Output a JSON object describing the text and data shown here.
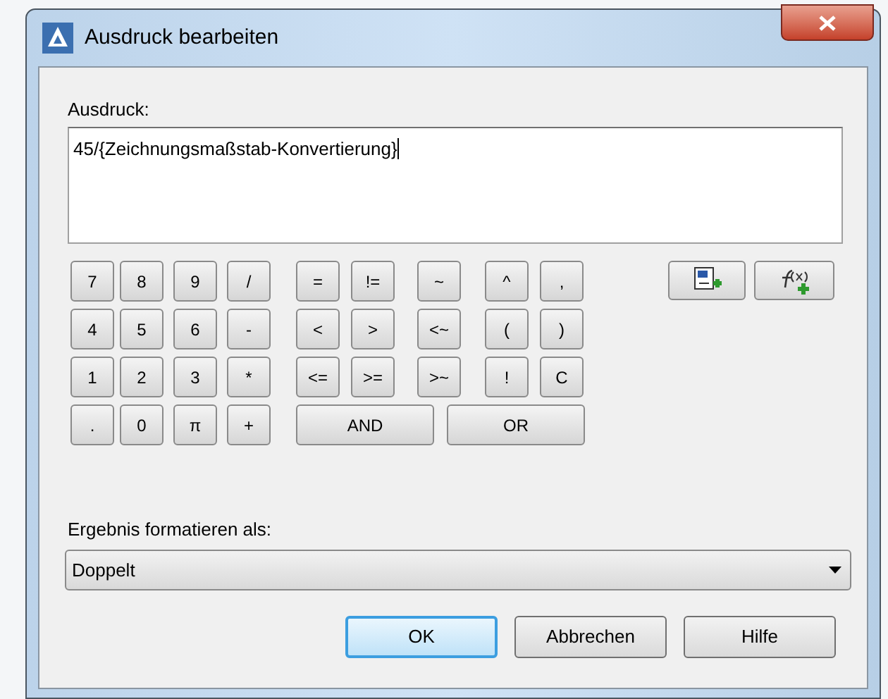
{
  "window": {
    "title": "Ausdruck bearbeiten"
  },
  "expression": {
    "label": "Ausdruck:",
    "value": "45/{Zeichnungsmaßstab-Konvertierung}"
  },
  "keypad": [
    [
      {
        "label": "7",
        "kind": "key"
      },
      {
        "label": "8",
        "kind": "key"
      },
      {
        "label": "9",
        "kind": "key"
      },
      {
        "label": "/",
        "kind": "key"
      },
      {
        "label": "=",
        "kind": "key"
      },
      {
        "label": "!=",
        "kind": "key"
      },
      {
        "label": "~",
        "kind": "key"
      },
      {
        "label": "^",
        "kind": "key"
      },
      {
        "label": ",",
        "kind": "key"
      }
    ],
    [
      {
        "label": "4",
        "kind": "key"
      },
      {
        "label": "5",
        "kind": "key"
      },
      {
        "label": "6",
        "kind": "key"
      },
      {
        "label": "-",
        "kind": "key"
      },
      {
        "label": "<",
        "kind": "key"
      },
      {
        "label": ">",
        "kind": "key"
      },
      {
        "label": "<~",
        "kind": "key"
      },
      {
        "label": "(",
        "kind": "key"
      },
      {
        "label": ")",
        "kind": "key"
      }
    ],
    [
      {
        "label": "1",
        "kind": "key"
      },
      {
        "label": "2",
        "kind": "key"
      },
      {
        "label": "3",
        "kind": "key"
      },
      {
        "label": "*",
        "kind": "key"
      },
      {
        "label": "<=",
        "kind": "key"
      },
      {
        "label": ">=",
        "kind": "key"
      },
      {
        "label": ">~",
        "kind": "key"
      },
      {
        "label": "!",
        "kind": "key"
      },
      {
        "label": "C",
        "kind": "key"
      }
    ],
    [
      {
        "label": ".",
        "kind": "key"
      },
      {
        "label": "0",
        "kind": "key"
      },
      {
        "label": "π",
        "kind": "key"
      },
      {
        "label": "+",
        "kind": "key"
      },
      {
        "label": "AND",
        "kind": "wide"
      },
      {
        "label": "OR",
        "kind": "wide"
      }
    ]
  ],
  "format": {
    "label": "Ergebnis formatieren als:",
    "value": "Doppelt"
  },
  "buttons": [
    {
      "label": "OK",
      "default": true
    },
    {
      "label": "Abbrechen",
      "default": false
    },
    {
      "label": "Hilfe",
      "default": false
    }
  ]
}
